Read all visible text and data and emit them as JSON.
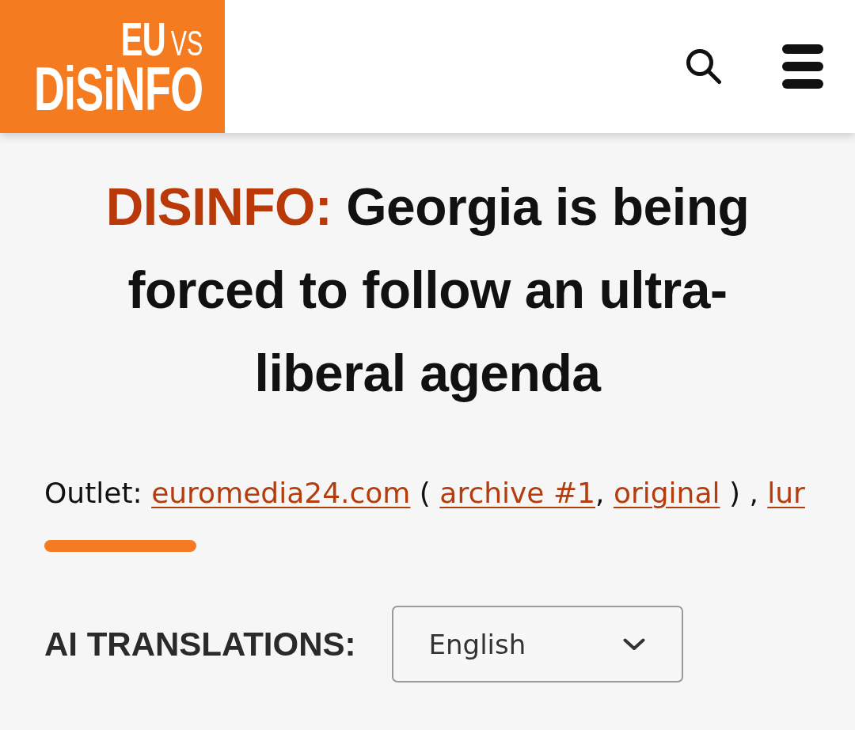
{
  "header": {
    "logo": {
      "top": "EU",
      "small": "VS",
      "bottom": "DiSiNFO"
    },
    "actions": [
      {
        "kind": "search"
      },
      {
        "kind": "menu"
      }
    ]
  },
  "headline": {
    "tag": "DISINFO:",
    "title": "Georgia is being forced to follow an ultra-liberal agenda"
  },
  "outlet": {
    "label": "Outlet:",
    "parts": [
      {
        "kind": "link",
        "text": "euromedia24.com"
      },
      {
        "kind": "text",
        "text": " ( "
      },
      {
        "kind": "link",
        "text": "archive #1"
      },
      {
        "kind": "text",
        "text": ", "
      },
      {
        "kind": "link",
        "text": "original"
      },
      {
        "kind": "text",
        "text": " ) , "
      },
      {
        "kind": "link",
        "text": "lur"
      }
    ]
  },
  "translations": {
    "label": "AI TRANSLATIONS:",
    "value": "English"
  }
}
